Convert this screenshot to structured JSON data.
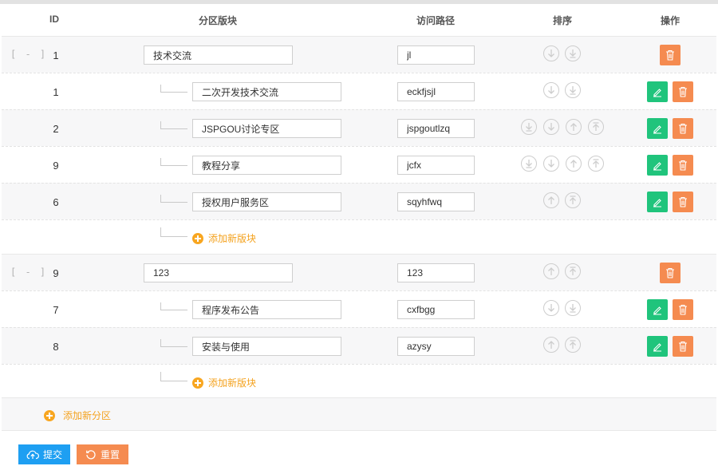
{
  "columns": {
    "id": "ID",
    "name": "分区版块",
    "path": "访问路径",
    "sort": "排序",
    "actions": "操作"
  },
  "collapse_symbol": "[ - ]",
  "zones": [
    {
      "id": "1",
      "name": "技术交流",
      "path": "jl",
      "boards": [
        {
          "id": "1",
          "name": "二次开发技术交流",
          "path": "eckfjsjl"
        },
        {
          "id": "2",
          "name": "JSPGOU讨论专区",
          "path": "jspgoutlzq"
        },
        {
          "id": "9",
          "name": "教程分享",
          "path": "jcfx"
        },
        {
          "id": "6",
          "name": "授权用户服务区",
          "path": "sqyhfwq"
        }
      ],
      "add_board_label": "添加新版块"
    },
    {
      "id": "9",
      "name": "123",
      "path": "123",
      "boards": [
        {
          "id": "7",
          "name": "程序发布公告",
          "path": "cxfbgg"
        },
        {
          "id": "8",
          "name": "安装与使用",
          "path": "azysy"
        }
      ],
      "add_board_label": "添加新版块"
    }
  ],
  "add_zone_label": "添加新分区",
  "buttons": {
    "submit": "提交",
    "reset": "重置"
  },
  "colors": {
    "edit": "#20c47c",
    "delete": "#f58b50",
    "submit": "#1e9ff2",
    "add": "#f8a620"
  }
}
